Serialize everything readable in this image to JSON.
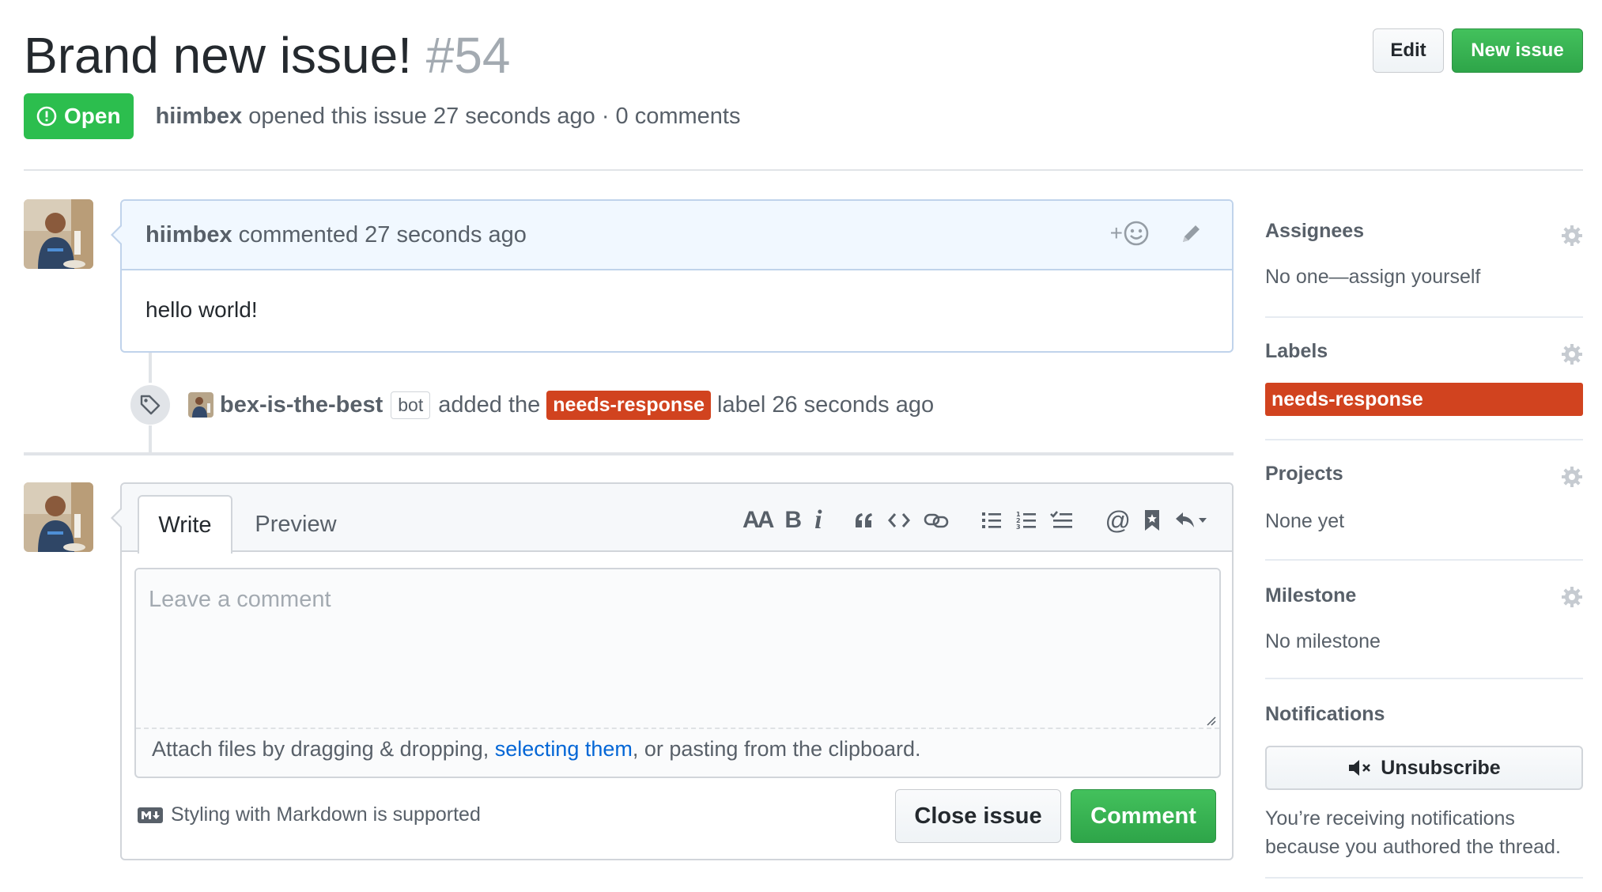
{
  "issue": {
    "title": "Brand new issue!",
    "number": "#54",
    "state": "Open",
    "author": "hiimbex",
    "meta": "opened this issue 27 seconds ago · 0 comments"
  },
  "header_actions": {
    "edit_label": "Edit",
    "new_issue_label": "New issue"
  },
  "comment": {
    "author": "hiimbex",
    "action": "commented 27 seconds ago",
    "reaction_label": "+",
    "body": "hello world!"
  },
  "event": {
    "actor": "bex-is-the-best",
    "badge": "bot",
    "text_before": "added the",
    "label": "needs-response",
    "text_after": "label 26 seconds ago"
  },
  "composer": {
    "tabs": [
      "Write",
      "Preview"
    ],
    "active_tab": "Write",
    "toolbar": {
      "header_text": "AA",
      "bold": "B",
      "italic": "i",
      "mention": "@"
    },
    "placeholder": "Leave a comment",
    "value": "",
    "drop_hint_before": "Attach files by dragging & dropping, ",
    "drop_hint_link": "selecting them",
    "drop_hint_after": ", or pasting from the clipboard.",
    "markdown_hint": "Styling with Markdown is supported",
    "close_label": "Close issue",
    "comment_label": "Comment"
  },
  "sidebar": {
    "assignees": {
      "heading": "Assignees",
      "value": "No one—assign yourself"
    },
    "labels": {
      "heading": "Labels",
      "items": [
        "needs-response"
      ]
    },
    "projects": {
      "heading": "Projects",
      "value": "None yet"
    },
    "milestone": {
      "heading": "Milestone",
      "value": "No milestone"
    },
    "notifications": {
      "heading": "Notifications",
      "button_label": "Unsubscribe",
      "reason": "You’re receiving notifications because you authored the thread."
    }
  },
  "colors": {
    "open_green": "#2cbe4e",
    "label_red": "#d1431f",
    "comment_header_bg": "#f1f8ff",
    "link_blue": "#0366d6"
  },
  "icons": {
    "state": "issue-opened-icon",
    "reaction": "smiley-icon",
    "edit": "pencil-icon",
    "event": "tag-icon",
    "settings": "gear-icon",
    "unsubscribe": "mute-icon",
    "markdown": "markdown-icon"
  }
}
